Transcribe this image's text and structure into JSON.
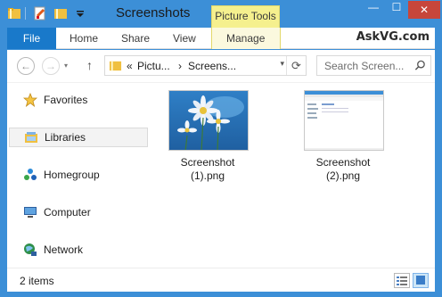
{
  "window": {
    "title": "Screenshots",
    "contextual_tab_group": "Picture Tools",
    "controls": {
      "minimize": "—",
      "maximize": "☐",
      "close": "✕"
    }
  },
  "ribbon": {
    "file_tab": "File",
    "tabs": [
      "Home",
      "Share",
      "View",
      "Manage"
    ],
    "watermark": "AskVG.com"
  },
  "nav": {
    "back": "←",
    "forward": "→",
    "up": "↑",
    "address": {
      "sep0": "«",
      "part1": "Pictu...",
      "sep1": "›",
      "part2": "Screens...",
      "dropdown": "▾"
    },
    "refresh": "⟳",
    "search_placeholder": "Search Screen..."
  },
  "navpane": {
    "items": [
      {
        "label": "Favorites",
        "icon": "star-icon"
      },
      {
        "label": "Libraries",
        "icon": "libraries-icon",
        "selected": true
      },
      {
        "label": "Homegroup",
        "icon": "homegroup-icon"
      },
      {
        "label": "Computer",
        "icon": "computer-icon"
      },
      {
        "label": "Network",
        "icon": "network-icon"
      }
    ]
  },
  "files": [
    {
      "name_line1": "Screenshot",
      "name_line2": "(1).png",
      "thumbnail": "daisies-wallpaper"
    },
    {
      "name_line1": "Screenshot",
      "name_line2": "(2).png",
      "thumbnail": "explorer-window"
    }
  ],
  "status": {
    "item_count": "2 items"
  },
  "colors": {
    "titlebar": "#3c8fd7",
    "file_tab": "#1979ca",
    "contextual": "#f5f08e"
  }
}
